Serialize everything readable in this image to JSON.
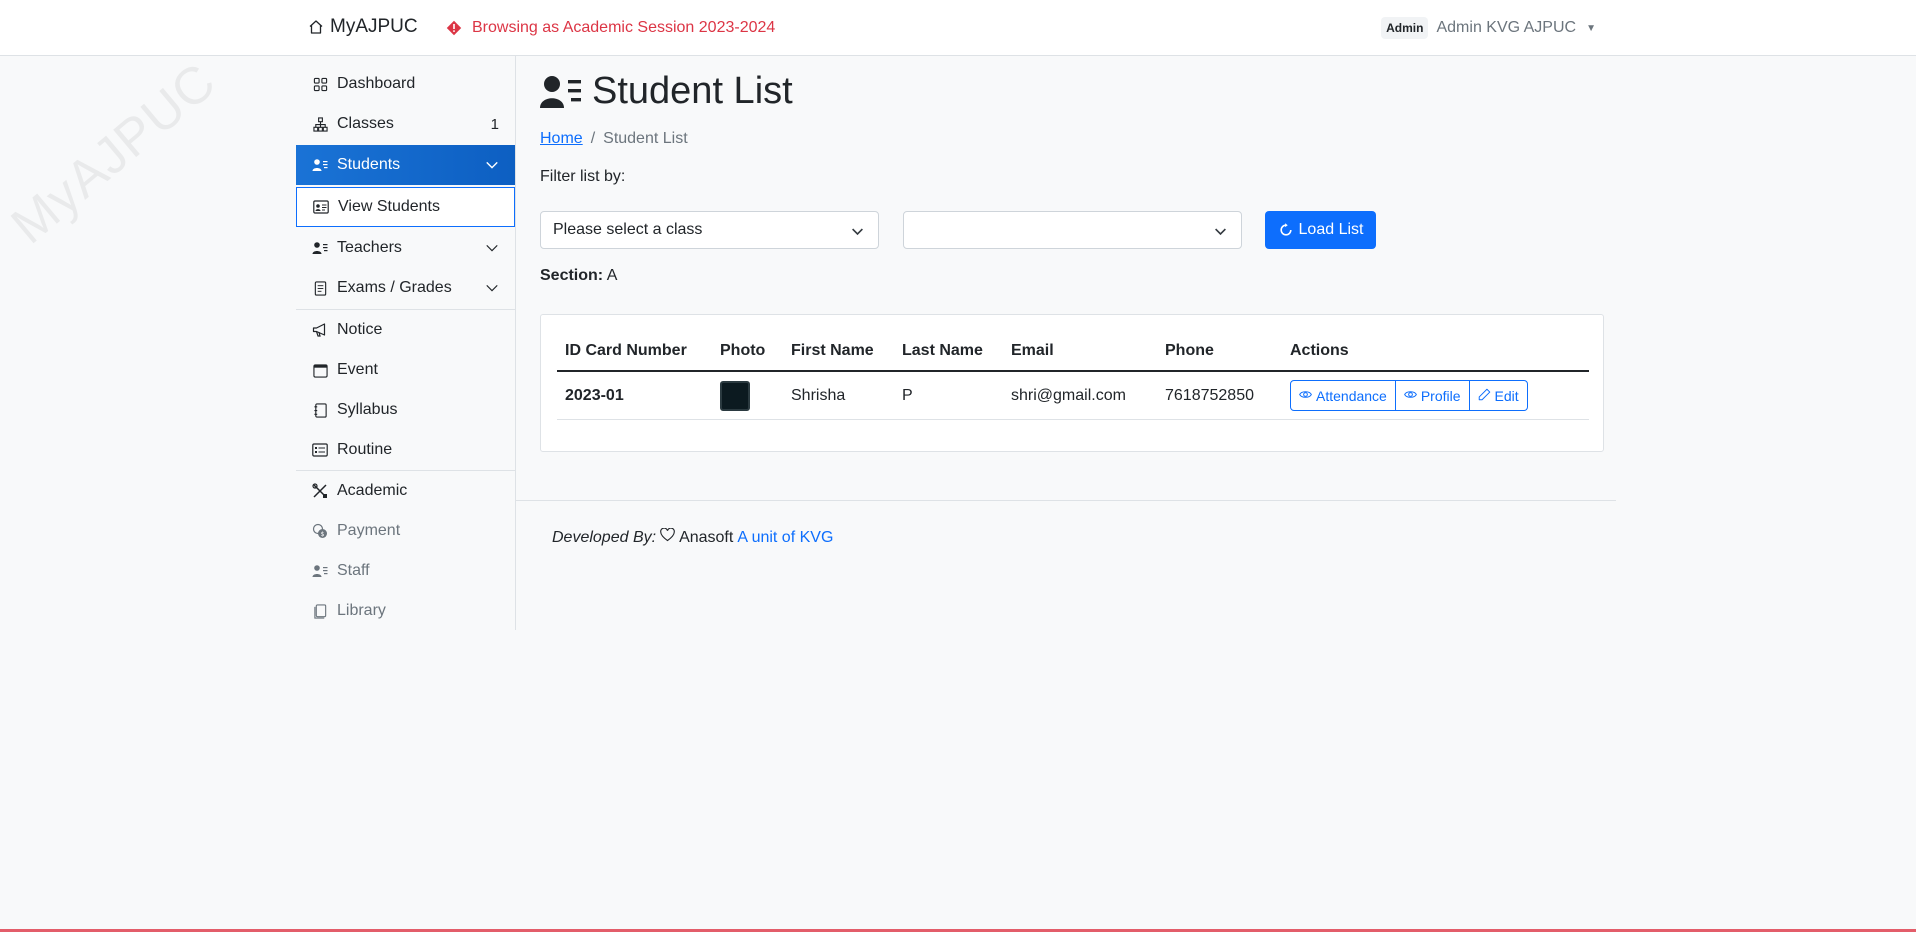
{
  "header": {
    "brand": "MyAJPUC",
    "session_notice": "Browsing as Academic Session 2023-2024",
    "role_badge": "Admin",
    "user_name": "Admin KVG AJPUC",
    "accent_color": "#dc3545"
  },
  "watermark": "MyAJPUC",
  "sidebar": {
    "items": [
      {
        "label": "Dashboard",
        "icon": "grid-icon"
      },
      {
        "label": "Classes",
        "icon": "diagram-icon",
        "count": "1"
      },
      {
        "label": "Students",
        "icon": "person-lines-icon",
        "active": true,
        "expanded": true
      },
      {
        "label": "View Students",
        "icon": "person-card-icon",
        "sub": true
      },
      {
        "label": "Teachers",
        "icon": "person-lines-icon"
      },
      {
        "label": "Exams / Grades",
        "icon": "file-text-icon"
      },
      {
        "label": "Notice",
        "icon": "megaphone-icon"
      },
      {
        "label": "Event",
        "icon": "calendar-icon"
      },
      {
        "label": "Syllabus",
        "icon": "journal-icon"
      },
      {
        "label": "Routine",
        "icon": "card-list-icon"
      },
      {
        "label": "Academic",
        "icon": "tools-icon"
      },
      {
        "label": "Payment",
        "icon": "coin-icon",
        "muted": true
      },
      {
        "label": "Staff",
        "icon": "person-lines-icon",
        "muted": true
      },
      {
        "label": "Library",
        "icon": "books-icon",
        "muted": true
      }
    ]
  },
  "page": {
    "title": "Student List",
    "breadcrumb_home": "Home",
    "breadcrumb_separator": "/",
    "breadcrumb_current": "Student List",
    "filter_label": "Filter list by:",
    "class_select_value": "Please select a class",
    "section_select_value": "",
    "load_button": "Load List",
    "section_label": "Section:",
    "section_value": "A"
  },
  "table": {
    "columns": [
      "ID Card Number",
      "Photo",
      "First Name",
      "Last Name",
      "Email",
      "Phone",
      "Actions"
    ],
    "rows": [
      {
        "id_card": "2023-01",
        "first_name": "Shrisha",
        "last_name": "P",
        "email": "shri@gmail.com",
        "phone": "7618752850",
        "actions": [
          "Attendance",
          "Profile",
          "Edit"
        ]
      }
    ]
  },
  "footer": {
    "developed_by": "Developed By:",
    "company": "Anasoft",
    "link": "A unit of KVG"
  }
}
